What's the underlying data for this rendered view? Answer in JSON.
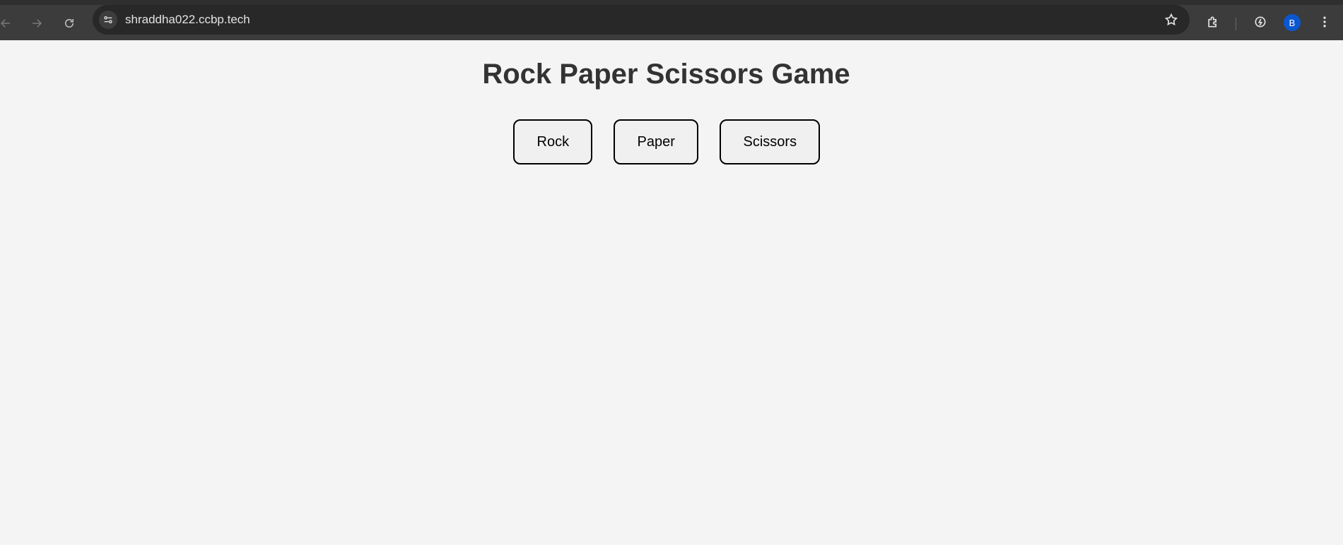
{
  "browser": {
    "url": "shraddha022.ccbp.tech",
    "profile_initial": "B",
    "accent_color": "#0b57d0",
    "icons": [
      "back-icon",
      "forward-icon",
      "reload-icon",
      "site-settings-icon",
      "bookmark-star-icon",
      "extensions-icon",
      "performance-icon",
      "menu-icon"
    ]
  },
  "page": {
    "title": "Rock Paper Scissors Game",
    "choices": {
      "rock": "Rock",
      "paper": "Paper",
      "scissors": "Scissors"
    }
  }
}
